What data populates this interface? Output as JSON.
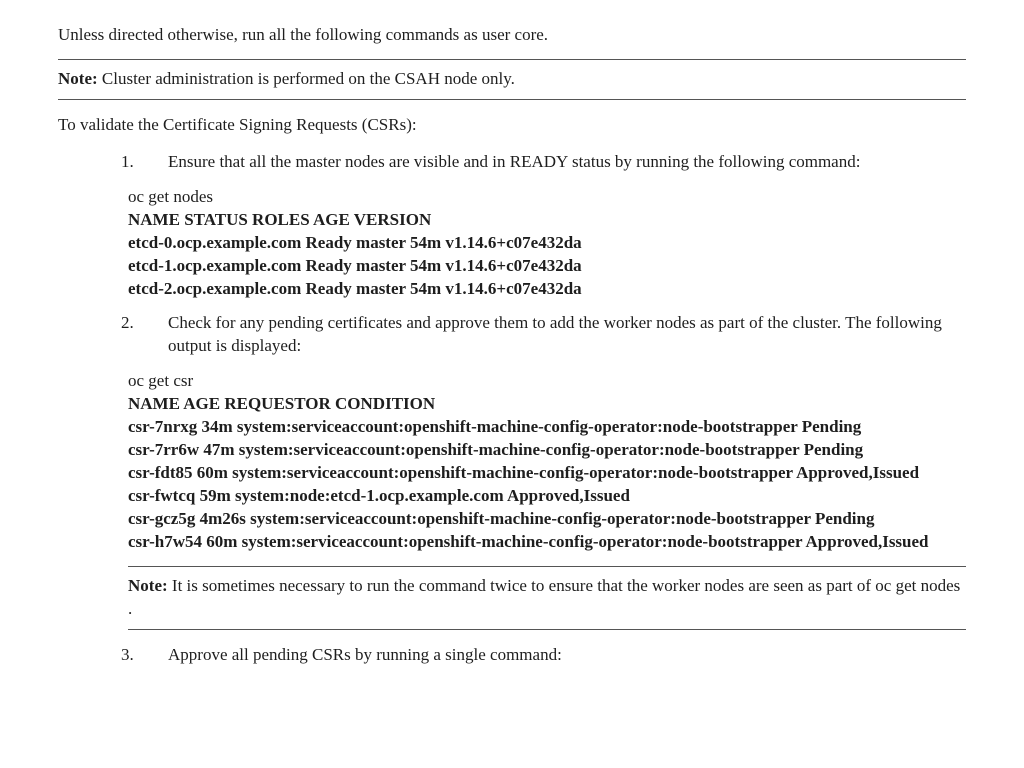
{
  "intro": "Unless directed otherwise, run all the following commands as user core.",
  "note1": {
    "label": "Note:",
    "text": " Cluster administration is performed on the CSAH node only."
  },
  "section_intro": "To validate the Certificate Signing Requests (CSRs):",
  "steps": {
    "s1": {
      "text": "Ensure that all the master nodes are visible and in READY status by running the following command:",
      "cmd": "oc get nodes",
      "out_header": "NAME STATUS ROLES AGE VERSION",
      "out_lines": [
        "etcd-0.ocp.example.com Ready master 54m v1.14.6+c07e432da",
        "etcd-1.ocp.example.com Ready master 54m v1.14.6+c07e432da",
        "etcd-2.ocp.example.com Ready master 54m v1.14.6+c07e432da"
      ]
    },
    "s2": {
      "text": "Check for any pending certificates and approve them to add the worker nodes as part of the cluster. The following output is displayed:",
      "cmd": "oc get csr",
      "out_header": "NAME AGE REQUESTOR CONDITION",
      "out_lines": [
        "csr-7nrxg 34m system:serviceaccount:openshift-machine-config-operator:node-bootstrapper Pending",
        "csr-7rr6w 47m system:serviceaccount:openshift-machine-config-operator:node-bootstrapper Pending",
        "csr-fdt85 60m system:serviceaccount:openshift-machine-config-operator:node-bootstrapper Approved,Issued",
        "csr-fwtcq 59m system:node:etcd-1.ocp.example.com Approved,Issued",
        "csr-gcz5g 4m26s system:serviceaccount:openshift-machine-config-operator:node-bootstrapper Pending",
        "csr-h7w54 60m system:serviceaccount:openshift-machine-config-operator:node-bootstrapper Approved,Issued"
      ],
      "note": {
        "label": "Note:",
        "text": " It is sometimes necessary to run the command twice to ensure that the worker nodes are seen as part of oc get nodes ."
      }
    },
    "s3": {
      "text": "Approve all pending CSRs by running a single command:"
    }
  }
}
